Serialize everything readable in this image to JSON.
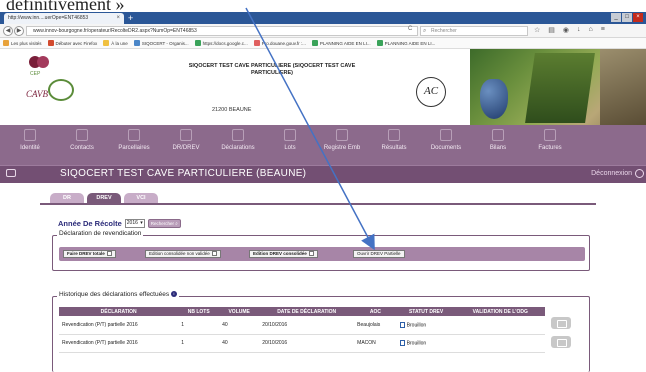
{
  "annotation": {
    "text": "définitivement »"
  },
  "browser": {
    "tab_title": "http://www.inn....uerOpe=ENT46853",
    "tab_close": "×",
    "new_tab": "+",
    "win_min": "_",
    "win_max": "□",
    "win_close": "×",
    "back": "◀",
    "forward": "▶",
    "url": "www.innov-bourgogne.fr/operateur/RecolteDR2.aspx?NumOp=ENT46853",
    "reload": "C",
    "search_placeholder": "Rechercher",
    "bookmarks": [
      {
        "label": "Les plus visités",
        "color": "#e8a23a"
      },
      {
        "label": "Débuter avec Firefox",
        "color": "#d24a2e"
      },
      {
        "label": "À la une",
        "color": "#f0c040"
      },
      {
        "label": "SIQOCERT - Organis...",
        "color": "#4a86c8"
      },
      {
        "label": "https://docs.google.c...",
        "color": "#3aa35a"
      },
      {
        "label": "Pro.douane.gouv.fr :...",
        "color": "#e06060"
      },
      {
        "label": "PLANNING AIDE EN LI...",
        "color": "#3aa35a"
      },
      {
        "label": "PLANNING AIDE EN LI...",
        "color": "#3aa35a"
      }
    ]
  },
  "header": {
    "cavb": "CAVB",
    "company_title": "SIQOCERT TEST CAVE PARTICULIERE (SIQOCERT TEST CAVE PARTICULIERE)",
    "city": "21200 BEAUNE",
    "aoc": "AC"
  },
  "menu": {
    "items": [
      {
        "label": "Identité"
      },
      {
        "label": "Contacts"
      },
      {
        "label": "Parcellaires"
      },
      {
        "label": "DR/DREV"
      },
      {
        "label": "Déclarations"
      },
      {
        "label": "Lots"
      },
      {
        "label": "Registre Emb"
      },
      {
        "label": "Résultats"
      },
      {
        "label": "Documents"
      },
      {
        "label": "Bilans"
      },
      {
        "label": "Factures"
      }
    ]
  },
  "banner": {
    "title": "SIQOCERT TEST CAVE PARTICULIERE (BEAUNE)",
    "logout": "Déconnexion"
  },
  "subtabs": [
    {
      "label": "DR"
    },
    {
      "label": "DREV"
    },
    {
      "label": "VCI"
    }
  ],
  "harvest": {
    "label": "Année De Récolte",
    "year": "2016",
    "search_button": "Rechercher"
  },
  "revendication": {
    "legend": "Déclaration de revendication",
    "buttons": [
      {
        "label": "Faire DREV totale",
        "bold": true
      },
      {
        "label": "Edition consolidée non validée",
        "bold": false
      },
      {
        "label": "Edition DREV consolidée",
        "bold": true
      },
      {
        "label": "Ouvrir DREV Partielle",
        "bold": false
      }
    ]
  },
  "history": {
    "legend": "Historique des déclarations effectuées",
    "info_icon": "i",
    "columns": [
      "DÉCLARATION",
      "NB LOTS",
      "VOLUME",
      "DATE DE DÉCLARATION",
      "AOC",
      "STATUT DREV",
      "VALIDATION DE L'ODG"
    ],
    "rows": [
      {
        "declaration": "Revendication (P/T) partielle 2016",
        "nb_lots": "1",
        "volume": "40",
        "date": "20/10/2016",
        "aoc": "Beaujolais",
        "statut": "Brouillon",
        "validation": ""
      },
      {
        "declaration": "Revendication (P/T) partielle 2016",
        "nb_lots": "1",
        "volume": "40",
        "date": "20/10/2016",
        "aoc": "MACON",
        "statut": "Brouillon",
        "validation": ""
      }
    ]
  }
}
